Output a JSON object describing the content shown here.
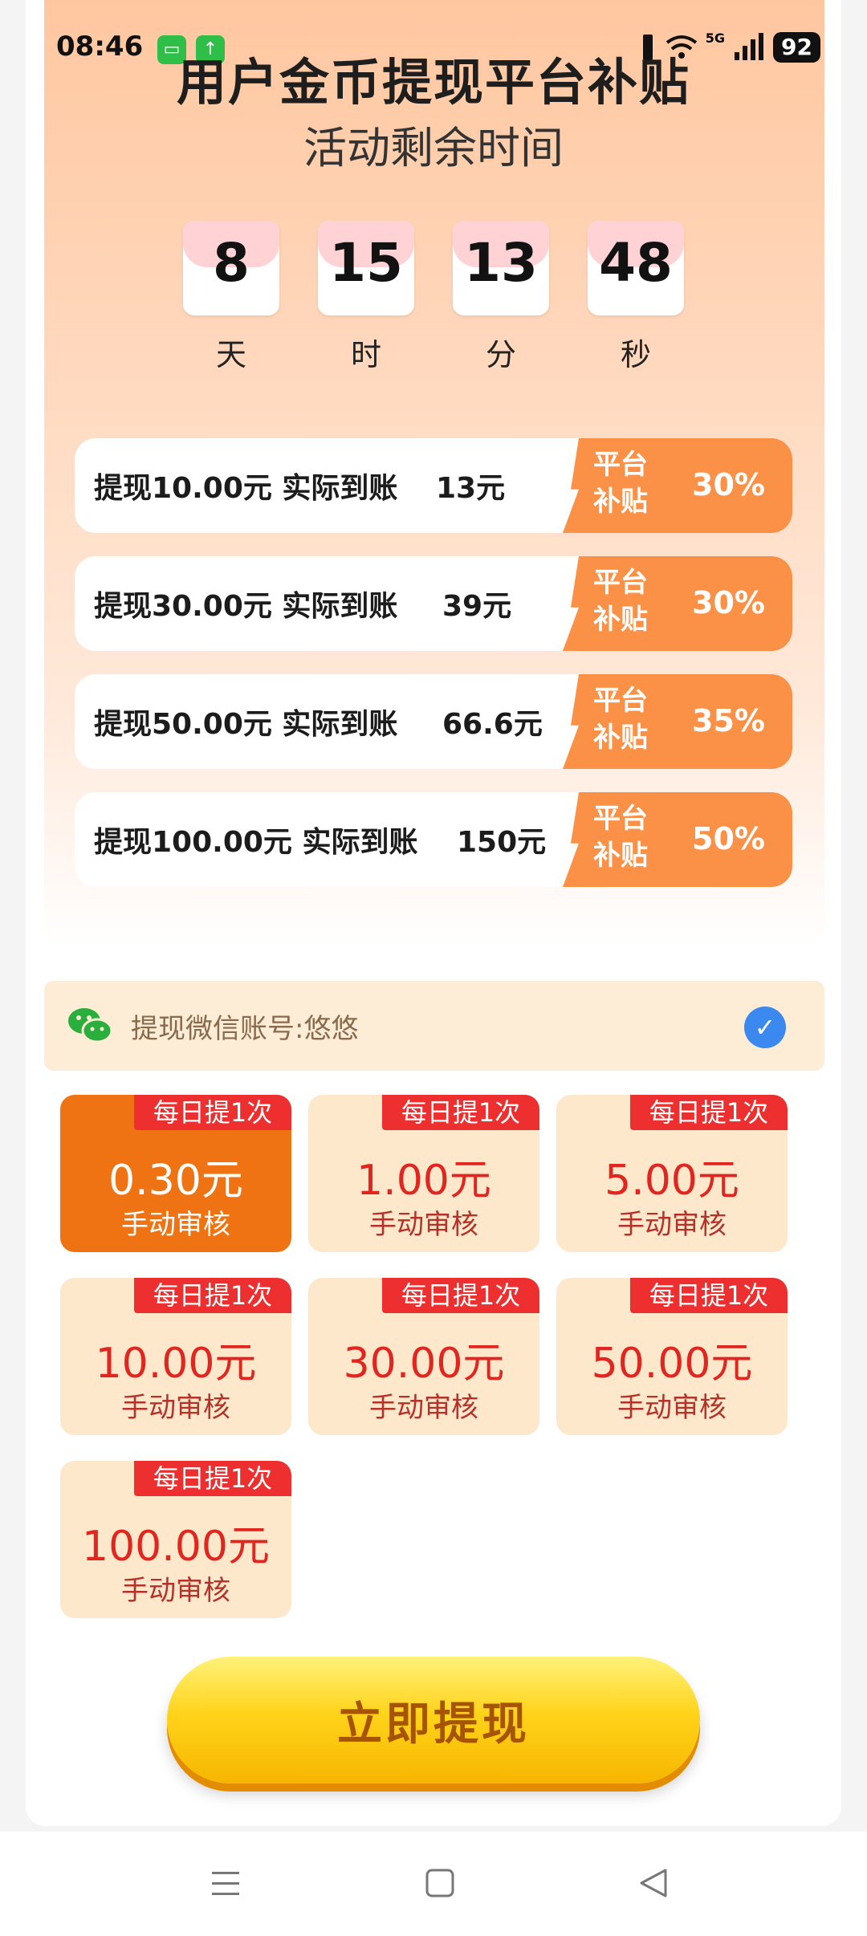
{
  "status": {
    "time": "08:46",
    "network": "5G",
    "battery": "92"
  },
  "header": {
    "title": "用户金币提现平台补贴",
    "subtitle": "活动剩余时间"
  },
  "countdown": [
    {
      "value": "8",
      "unit": "天"
    },
    {
      "value": "15",
      "unit": "时"
    },
    {
      "value": "13",
      "unit": "分"
    },
    {
      "value": "48",
      "unit": "秒"
    }
  ],
  "tiers": [
    {
      "text": "提现10.00元 实际到账",
      "amount": "13元",
      "badge": "平台补贴",
      "percent": "30%"
    },
    {
      "text": "提现30.00元 实际到账",
      "amount": "39元",
      "badge": "平台补贴",
      "percent": "30%"
    },
    {
      "text": "提现50.00元 实际到账",
      "amount": "66.6元",
      "badge": "平台补贴",
      "percent": "35%"
    },
    {
      "text": "提现100.00元 实际到账",
      "amount": "150元",
      "badge": "平台补贴",
      "percent": "50%"
    }
  ],
  "account": {
    "label": "提现微信账号:悠悠",
    "icon": "wechat-icon",
    "check": "✓"
  },
  "options": [
    {
      "tag": "每日提1次",
      "amount": "0.30元",
      "note": "手动审核",
      "selected": true
    },
    {
      "tag": "每日提1次",
      "amount": "1.00元",
      "note": "手动审核",
      "selected": false
    },
    {
      "tag": "每日提1次",
      "amount": "5.00元",
      "note": "手动审核",
      "selected": false
    },
    {
      "tag": "每日提1次",
      "amount": "10.00元",
      "note": "手动审核",
      "selected": false
    },
    {
      "tag": "每日提1次",
      "amount": "30.00元",
      "note": "手动审核",
      "selected": false
    },
    {
      "tag": "每日提1次",
      "amount": "50.00元",
      "note": "手动审核",
      "selected": false
    },
    {
      "tag": "每日提1次",
      "amount": "100.00元",
      "note": "手动审核",
      "selected": false
    }
  ],
  "action": {
    "withdraw_label": "立即提现"
  },
  "colors": {
    "accent_orange": "#ef7312",
    "badge_orange": "#fb9146",
    "tag_red": "#ee2f2f",
    "button_yellow": "#ffd31a",
    "check_blue": "#3b88ee"
  }
}
